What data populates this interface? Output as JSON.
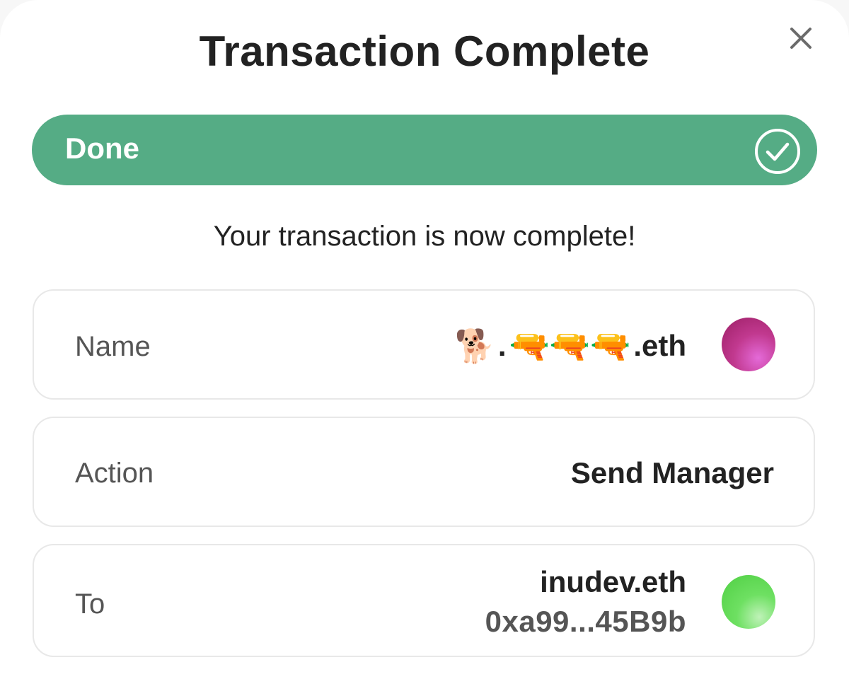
{
  "dialog": {
    "title": "Transaction Complete",
    "close_icon": "close-icon"
  },
  "progress": {
    "label": "Done",
    "status_icon": "checkmark-circle-icon",
    "percent": 100,
    "color": "#55ac85"
  },
  "message": "Your transaction is now complete!",
  "details": {
    "name": {
      "label": "Name",
      "dog": "🐕",
      "dot": ".",
      "pistols": "🔫🔫🔫",
      "suffix": ".eth",
      "avatar_color": "#c1398f"
    },
    "action": {
      "label": "Action",
      "value": "Send Manager"
    },
    "to": {
      "label": "To",
      "name": "inudev.eth",
      "address": "0xa99...45B9b",
      "avatar_color": "#5fd453"
    }
  }
}
